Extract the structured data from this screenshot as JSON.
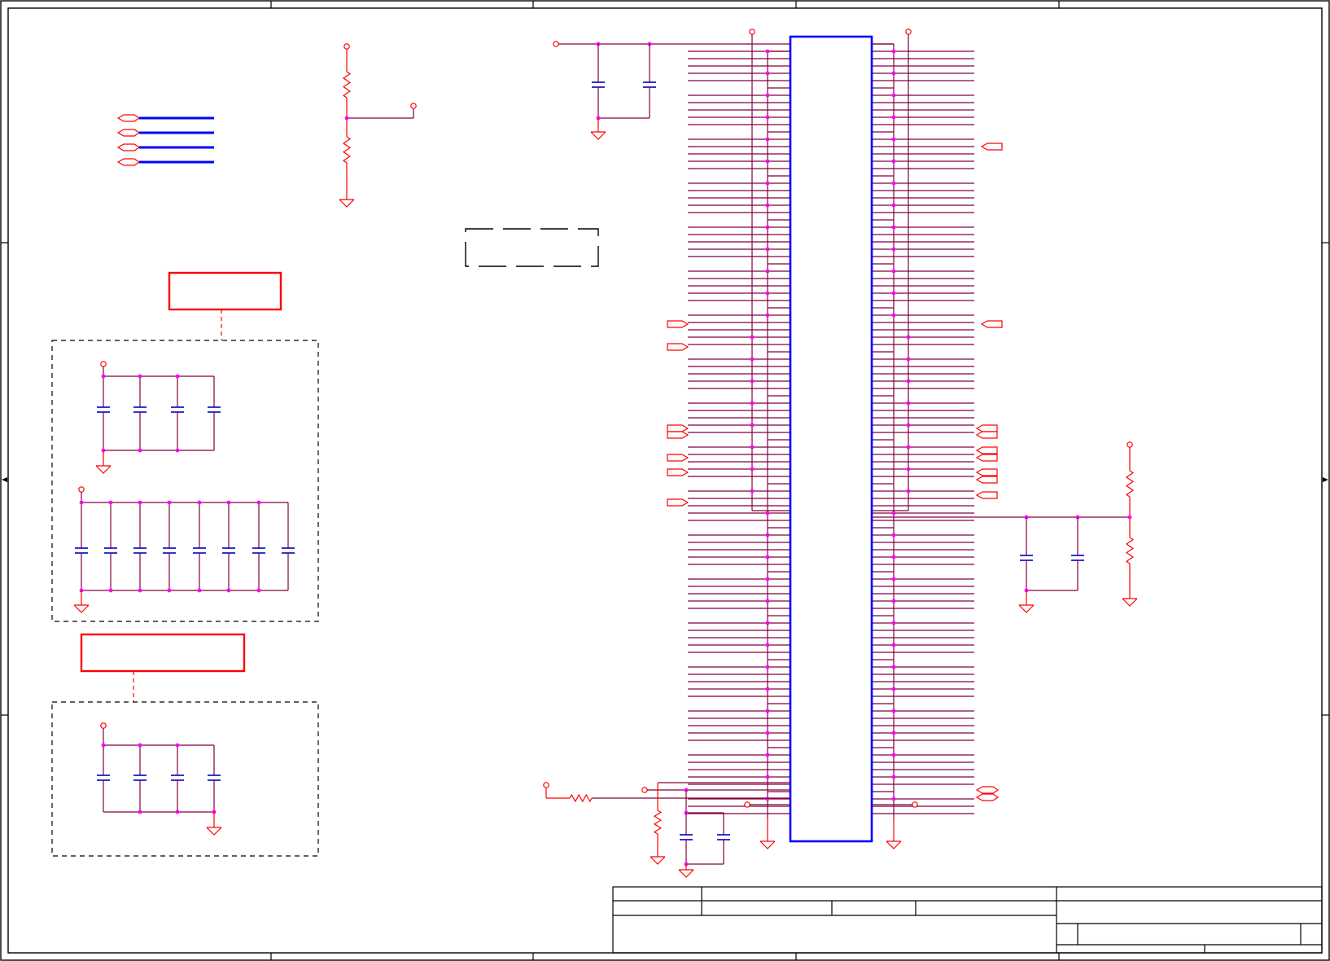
{
  "colors": {
    "frame": "#000000",
    "wire": "#800040",
    "junction": "#ff00ff",
    "power": "#ff0000",
    "cap": "#0000c0",
    "bus": "#0000ff",
    "ic": "#0000ff",
    "port": "#ff0000",
    "group": "#000000"
  },
  "symbols": {
    "resistor": "zigzag-resistor-icon",
    "capacitor": "capacitor-icon",
    "ground": "ground-triangle-icon",
    "power": "power-pin-icon",
    "port": "offpage-port-icon",
    "junction": "junction-dot-icon"
  },
  "labels": {}
}
